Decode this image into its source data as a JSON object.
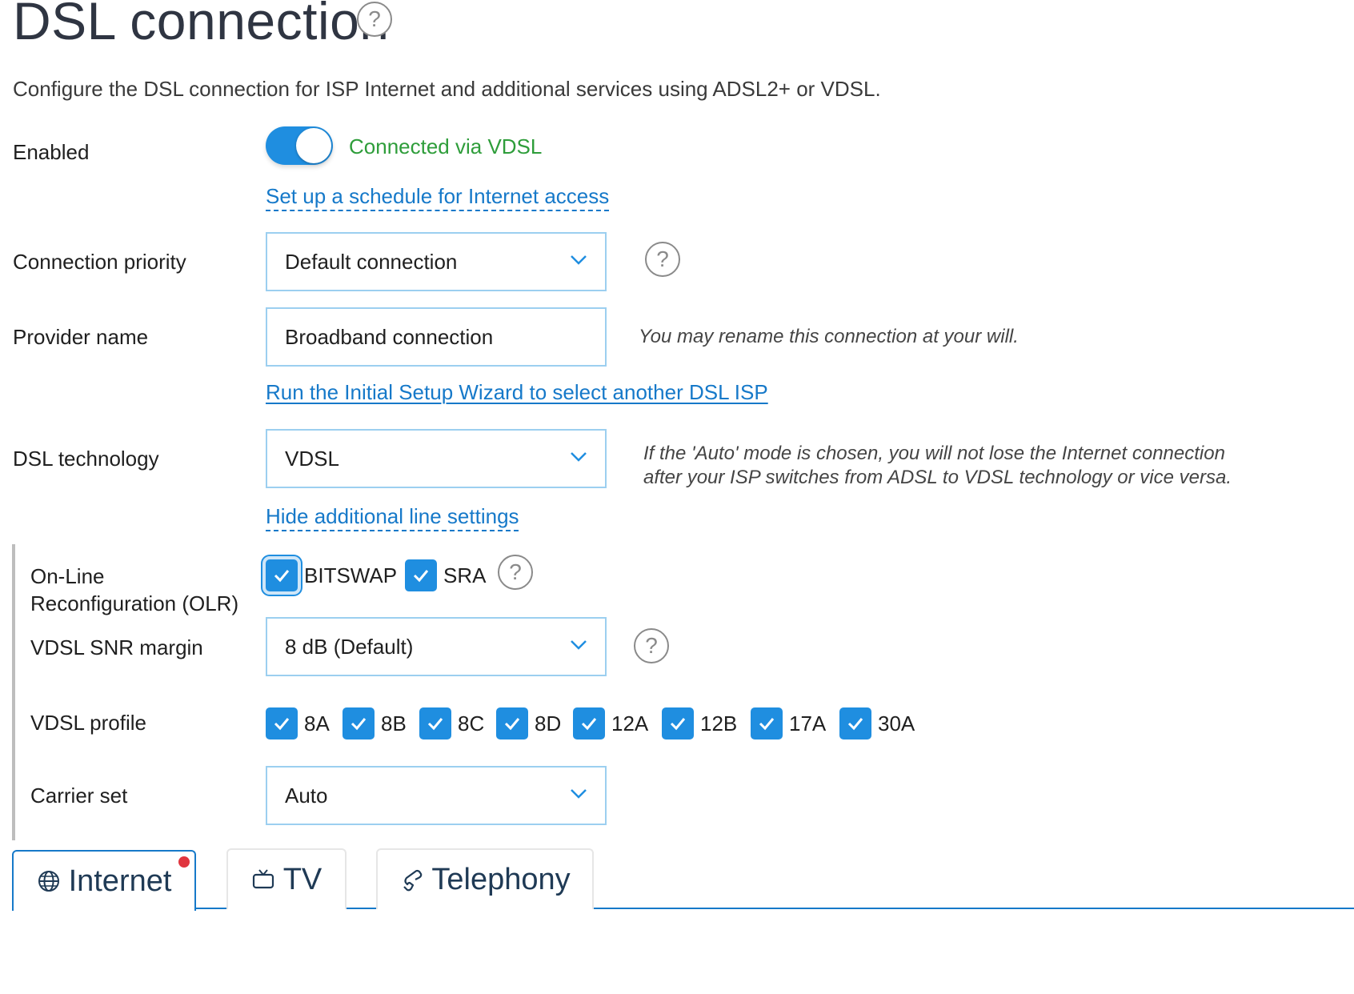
{
  "page": {
    "title": "DSL connection",
    "description": "Configure the DSL connection for ISP Internet and additional services using ADSL2+ or VDSL."
  },
  "enabled": {
    "label": "Enabled",
    "on": true,
    "status": "Connected via VDSL"
  },
  "schedule_link": "Set up a schedule for Internet access",
  "priority": {
    "label": "Connection priority",
    "value": "Default connection"
  },
  "provider": {
    "label": "Provider name",
    "value": "Broadband connection",
    "hint": "You may rename this connection at your will."
  },
  "wizard_link": "Run the Initial Setup Wizard to select another DSL ISP",
  "technology": {
    "label": "DSL technology",
    "value": "VDSL",
    "hint_line1": "If the 'Auto' mode is chosen, you will not lose the Internet connection",
    "hint_line2": "after your ISP switches from ADSL to VDSL technology or vice versa."
  },
  "hide_link": "Hide additional line settings",
  "olr": {
    "label_line1": "On-Line",
    "label_line2": "Reconfiguration (OLR)",
    "bitswap": "BITSWAP",
    "sra": "SRA"
  },
  "snr": {
    "label": "VDSL SNR margin",
    "value": "8 dB (Default)"
  },
  "profile": {
    "label": "VDSL profile",
    "options": [
      "8A",
      "8B",
      "8C",
      "8D",
      "12A",
      "12B",
      "17A",
      "30A"
    ]
  },
  "carrier": {
    "label": "Carrier set",
    "value": "Auto"
  },
  "tabs": [
    {
      "label": "Internet",
      "icon": "globe-icon",
      "active": true,
      "badge": true
    },
    {
      "label": "TV",
      "icon": "tv-icon",
      "active": false
    },
    {
      "label": "Telephony",
      "icon": "phone-icon",
      "active": false
    }
  ],
  "colors": {
    "accent": "#1f8ee0",
    "link": "#1679c9",
    "status_ok": "#2e9d3a",
    "badge": "#e0353f"
  }
}
